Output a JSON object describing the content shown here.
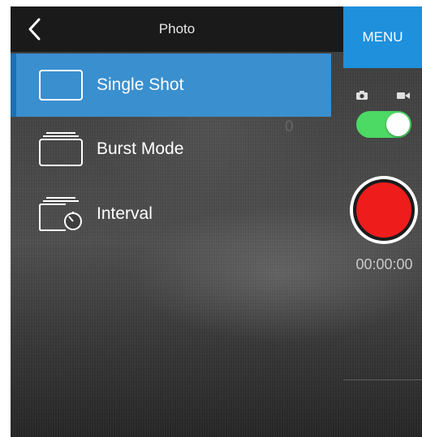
{
  "header": {
    "back_icon": "chevron-left-icon",
    "title": "Photo",
    "menu_label": "MENU"
  },
  "menu": {
    "items": [
      {
        "label": "Single Shot",
        "icon": "single-frame-icon",
        "selected": true
      },
      {
        "label": "Burst Mode",
        "icon": "stacked-frames-icon",
        "selected": false
      },
      {
        "label": "Interval",
        "icon": "interval-timer-icon",
        "selected": false
      }
    ]
  },
  "overlay": {
    "stray_text": "0"
  },
  "controls": {
    "photo_mode_icon": "camera-icon",
    "video_mode_icon": "video-camera-icon",
    "mode_toggle_on": true,
    "record_button_icon": "record-button-icon",
    "timer": "00:00:00"
  },
  "colors": {
    "accent": "#1e90dc",
    "selected_row": "#3a8fcf",
    "toggle_on": "#4cd964",
    "record": "#ef1c1c"
  }
}
